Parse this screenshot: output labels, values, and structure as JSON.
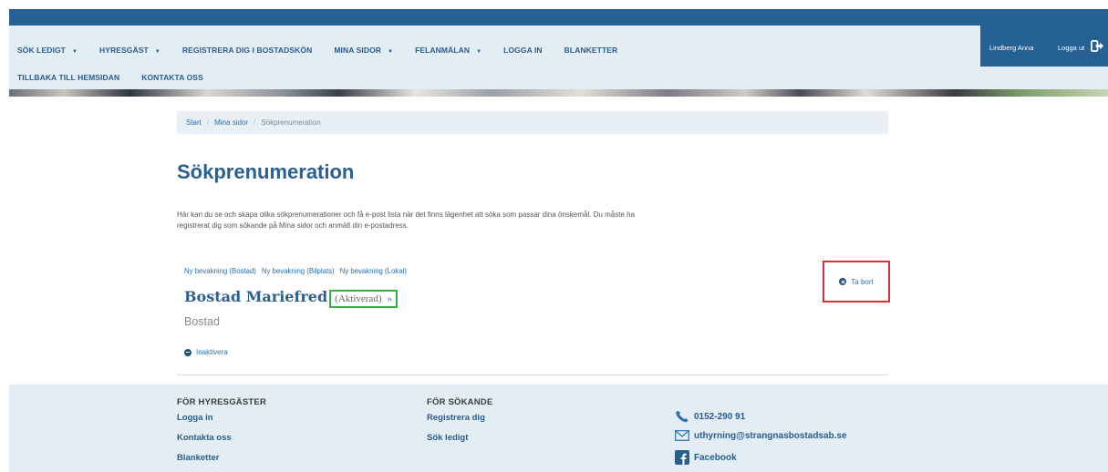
{
  "nav": {
    "row1": [
      {
        "label": "SÖK LEDIGT",
        "dropdown": true
      },
      {
        "label": "HYRESGÄST",
        "dropdown": true
      },
      {
        "label": "REGISTRERA DIG I BOSTADSKÖN",
        "dropdown": false
      },
      {
        "label": "MINA SIDOR",
        "dropdown": true
      },
      {
        "label": "FELANMÄLAN",
        "dropdown": true
      },
      {
        "label": "LOGGA IN",
        "dropdown": false
      },
      {
        "label": "BLANKETTER",
        "dropdown": false
      }
    ],
    "row2": [
      {
        "label": "TILLBAKA TILL HEMSIDAN"
      },
      {
        "label": "KONTAKTA OSS"
      }
    ],
    "caret": "▼"
  },
  "user": {
    "name": "Lindberg Anna",
    "logout_label": "Logga ut"
  },
  "breadcrumb": {
    "items": [
      "Start",
      "Mina sidor",
      "Sökprenumeration"
    ],
    "separator": "/"
  },
  "page": {
    "title": "Sökprenumeration",
    "intro": "Här kan du se och skapa olika sökprenumerationer och få e-post lista när det finns lägenhet att söka som passar dina önskemål. Du måste ha registrerat dig som sökande på Mina sidor och anmält din e-postadress."
  },
  "links": [
    "Ny bevakning (Bostad)",
    "Ny bevakning (Bilplats)",
    "Ny bevakning (Lokal)"
  ],
  "subscription": {
    "name": "Bostad Mariefred",
    "status": "(Aktiverad)",
    "arrow": "»",
    "type": "Bostad",
    "deactivate_label": "Inaktivera",
    "remove_label": "Ta bort"
  },
  "footer": {
    "col1": {
      "heading": "FÖR HYRESGÄSTER",
      "items": [
        "Logga in",
        "Kontakta oss",
        "Blanketter"
      ]
    },
    "col2": {
      "heading": "FÖR SÖKANDE",
      "items": [
        "Registrera dig",
        "Sök ledigt"
      ]
    },
    "contact": {
      "phone": "0152-290 91",
      "email": "uthyrning@strangnasbostadsab.se",
      "facebook": "Facebook"
    }
  },
  "colors": {
    "brand_blue": "#266195",
    "link": "#2a6fb0",
    "highlight_green": "#36b04a",
    "highlight_red": "#d9303a"
  }
}
